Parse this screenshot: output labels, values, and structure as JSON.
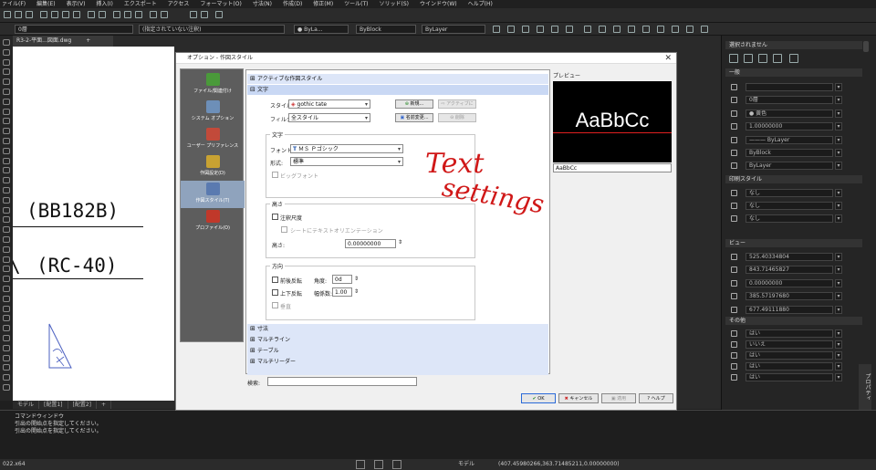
{
  "app": {
    "menu": [
      "ァイル(F)",
      "編集(E)",
      "表示(V)",
      "挿入(I)",
      "エクスポート",
      "アクセス",
      "フォーマット(O)",
      "寸法(N)",
      "作成(D)",
      "修正(M)",
      "ツール(T)",
      "ソリッド(S)",
      "ウインドウ(W)",
      "ヘルプ(H)"
    ],
    "toolbar_row1": {
      "layer": "0",
      "color": "● ByLa...",
      "linetype": "ByBlock",
      "lineweight": "ByLayer"
    },
    "toolbar_row2": {
      "textstyle": "(指定されていない注釈)",
      "layer_combo": "0層"
    }
  },
  "document": {
    "tab_label": "R3-2-平面...図面.dwg",
    "add_tab": "+",
    "cad_text_1": "(BB182B)",
    "cad_text_2": "(RC-40)",
    "cad_mark": "\\",
    "layout_tabs": [
      "モデル",
      "[配置1]",
      "[配置2]",
      "+"
    ]
  },
  "command": {
    "title": "コマンドウィンドウ",
    "line1": "引出の開始点を指定してください。",
    "line2": "引出の開始点を指定してください。"
  },
  "status": {
    "left": "022.x64",
    "coords": "(407.45980266,363.71485211,0.00000000)",
    "model": "モデル"
  },
  "right_panel": {
    "title": "選択されません",
    "general": "一般",
    "general_rows": [
      "",
      "0層",
      "● 黄色",
      "1.00000000",
      "——— ByLayer",
      "ByBlock",
      "ByLayer"
    ],
    "print_style": "印刷スタイル",
    "print_rows": [
      "なし",
      "なし",
      "なし"
    ],
    "view": "ビュー",
    "view_rows": [
      "525.40334804",
      "843.71465827",
      "0.00000000",
      "385.57197680",
      "677.49111880"
    ],
    "misc": "その他",
    "misc_rows": [
      "はい",
      "いいえ",
      "はい",
      "はい",
      "はい"
    ],
    "side_label": "プロパティ"
  },
  "dialog": {
    "title": "オプション - 作図スタイル",
    "close": "✕",
    "nav": [
      {
        "label": "ファイル/関連付け"
      },
      {
        "label": "システム オプション"
      },
      {
        "label": "ユーザー プリファレンス"
      },
      {
        "label": "作図設定(D)"
      },
      {
        "label": "作図スタイル(T)"
      },
      {
        "label": "プロファイル(O)"
      }
    ],
    "sections": {
      "active": "アクティブな作図スタイル",
      "text": "文字",
      "dim": "寸法",
      "multiline": "マルチライン",
      "table": "テーブル",
      "mleader": "マルチリーダー"
    },
    "style_label": "スタイル:",
    "style_value": "gothic tate",
    "filter_label": "フィルタ:",
    "filter_value": "全スタイル",
    "btn_new": "新規...",
    "btn_activate": "アクティブに",
    "btn_rename": "名前変更...",
    "btn_delete": "削除",
    "grp_text": "文字",
    "font_label": "フォント:",
    "font_value": "ＭＳ Ｐゴシック",
    "format_label": "形式:",
    "format_value": "標準",
    "bigfont_label": "ビッグフォント",
    "grp_height": "高さ",
    "annot_label": "注釈尺度",
    "match_label": "シートにテキストオリエンテーション",
    "height_label": "高さ:",
    "height_value": "0.00000000",
    "grp_dir": "方向",
    "backward_label": "前後反転",
    "angle_label": "角度:",
    "angle_value": "0d",
    "upside_label": "上下反転",
    "width_label": "幅係数:",
    "width_value": "1.00",
    "vertical_label": "垂直",
    "preview_label": "プレビュー",
    "preview_text": "AaBbCc",
    "preview_input": "AaBbCc",
    "search_label": "検索:",
    "btn_ok": "OK",
    "btn_cancel": "キャンセル",
    "btn_apply": "適用",
    "btn_help": "ヘルプ"
  },
  "annotation": {
    "line1": "Text",
    "line2": "settings"
  }
}
